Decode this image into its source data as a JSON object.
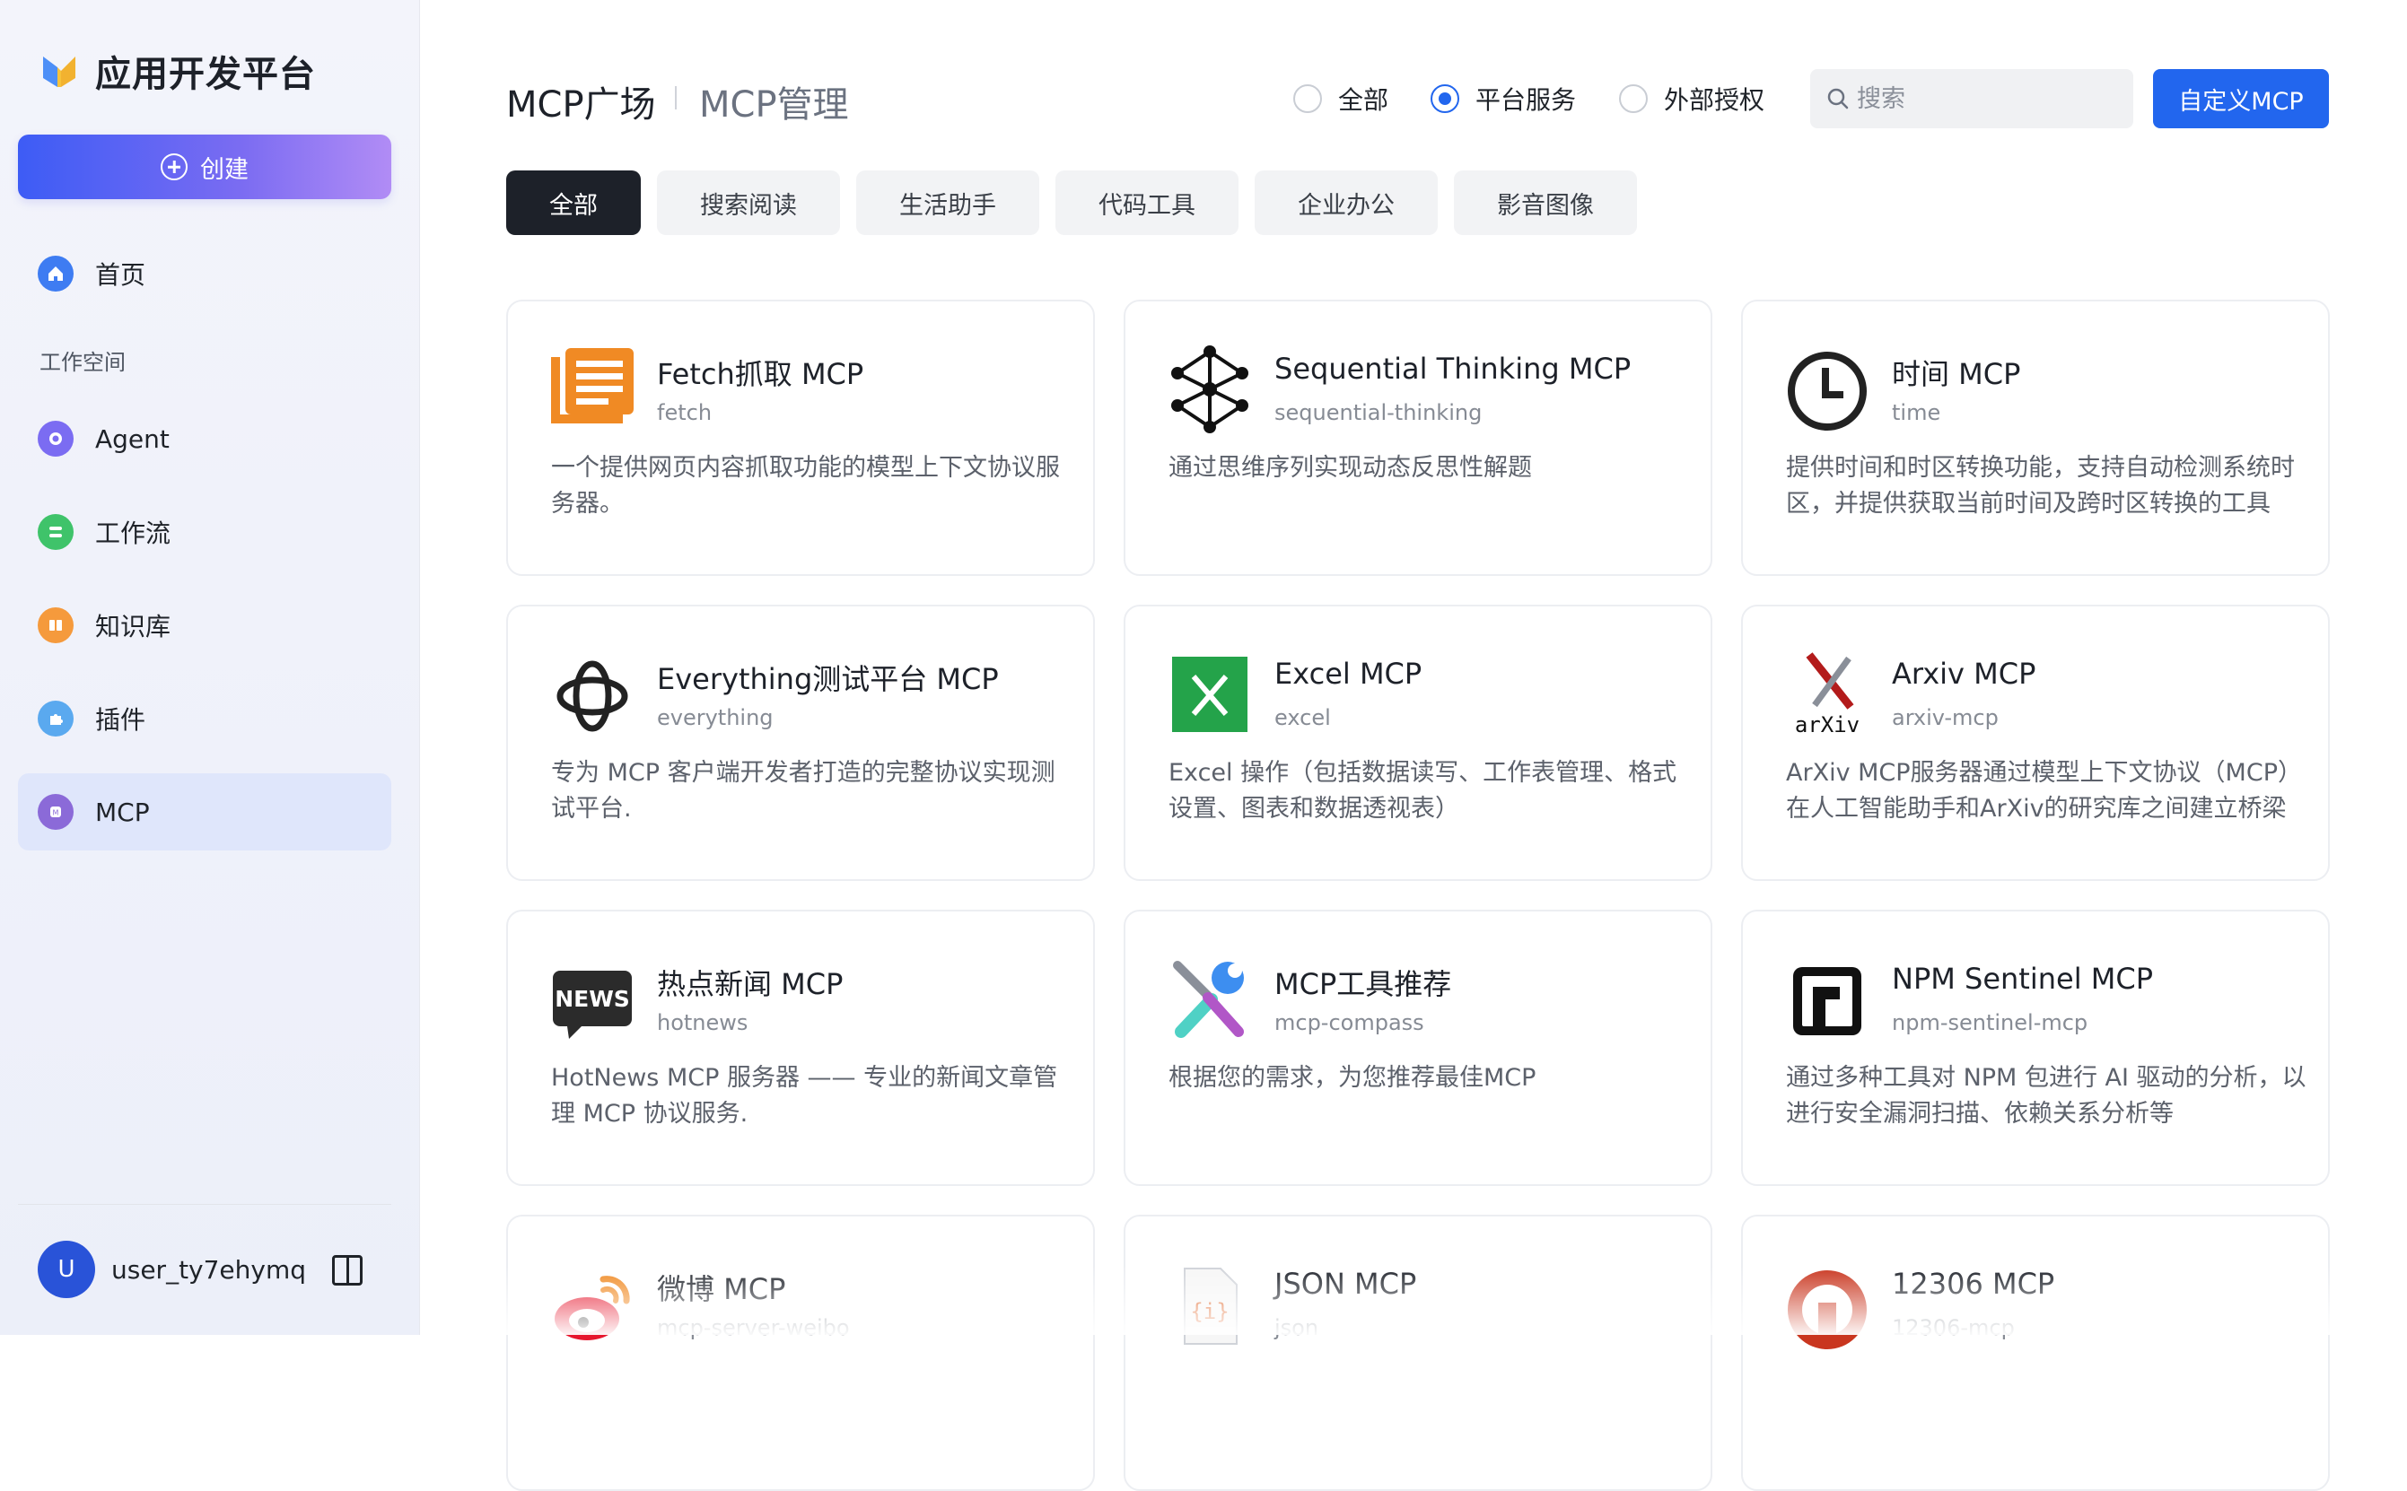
{
  "app": {
    "title": "应用开发平台"
  },
  "sidebar": {
    "create_label": "创建",
    "home_label": "首页",
    "workspace_label": "工作空间",
    "items": [
      {
        "label": "Agent",
        "icon": "agent-icon",
        "color": "#7b6cf2"
      },
      {
        "label": "工作流",
        "icon": "workflow-icon",
        "color": "#3fc36a"
      },
      {
        "label": "知识库",
        "icon": "knowledge-icon",
        "color": "#f59a3c"
      },
      {
        "label": "插件",
        "icon": "plugin-icon",
        "color": "#5aa9ef"
      },
      {
        "label": "MCP",
        "icon": "mcp-icon",
        "color": "#8b6ad8",
        "active": true
      }
    ],
    "home_color": "#3e7cf2",
    "user": {
      "avatar_letter": "U",
      "name": "user_ty7ehymq"
    }
  },
  "header": {
    "title": "MCP广场",
    "subtitle": "MCP管理",
    "filters": [
      {
        "label": "全部",
        "selected": false
      },
      {
        "label": "平台服务",
        "selected": true
      },
      {
        "label": "外部授权",
        "selected": false
      }
    ],
    "search_placeholder": "搜索",
    "custom_button": "自定义MCP"
  },
  "categories": [
    "全部",
    "搜索阅读",
    "生活助手",
    "代码工具",
    "企业办公",
    "影音图像"
  ],
  "active_category": "全部",
  "cards": [
    {
      "title": "Fetch抓取 MCP",
      "slug": "fetch",
      "desc": "一个提供网页内容抓取功能的模型上下文协议服务器。",
      "icon": "fetch-icon"
    },
    {
      "title": "Sequential Thinking MCP",
      "slug": "sequential-thinking",
      "desc": "通过思维序列实现动态反思性解题",
      "icon": "sequential-thinking-icon"
    },
    {
      "title": "时间 MCP",
      "slug": "time",
      "desc": "提供时间和时区转换功能，支持自动检测系统时区，并提供获取当前时间及跨时区转换的工具",
      "icon": "clock-icon"
    },
    {
      "title": "Everything测试平台 MCP",
      "slug": "everything",
      "desc": "专为 MCP 客户端开发者打造的完整协议实现测试平台.",
      "icon": "everything-icon"
    },
    {
      "title": "Excel MCP",
      "slug": "excel",
      "desc": "Excel 操作（包括数据读写、工作表管理、格式设置、图表和数据透视表）",
      "icon": "excel-icon"
    },
    {
      "title": "Arxiv MCP",
      "slug": "arxiv-mcp",
      "desc": "ArXiv MCP服务器通过模型上下文协议（MCP）在人工智能助手和ArXiv的研究库之间建立桥梁",
      "icon": "arxiv-icon",
      "icon_text": "arXiv"
    },
    {
      "title": "热点新闻 MCP",
      "slug": "hotnews",
      "desc": "HotNews MCP 服务器 —— 专业的新闻文章管理 MCP 协议服务.",
      "icon": "news-icon",
      "icon_text": "NEWS"
    },
    {
      "title": "MCP工具推荐",
      "slug": "mcp-compass",
      "desc": "根据您的需求，为您推荐最佳MCP",
      "icon": "tools-icon"
    },
    {
      "title": "NPM Sentinel MCP",
      "slug": "npm-sentinel-mcp",
      "desc": "通过多种工具对 NPM 包进行 AI 驱动的分析，以进行安全漏洞扫描、依赖关系分析等",
      "icon": "npm-icon"
    },
    {
      "title": "微博 MCP",
      "slug": "mcp-server-weibo",
      "desc": "",
      "icon": "weibo-icon"
    },
    {
      "title": "JSON MCP",
      "slug": "json",
      "desc": "",
      "icon": "json-icon",
      "icon_text": "{i}"
    },
    {
      "title": "12306 MCP",
      "slug": "12306-mcp",
      "desc": "",
      "icon": "train-12306-icon"
    }
  ],
  "colors": {
    "accent": "#2266ee",
    "active_chip": "#1d2129"
  }
}
